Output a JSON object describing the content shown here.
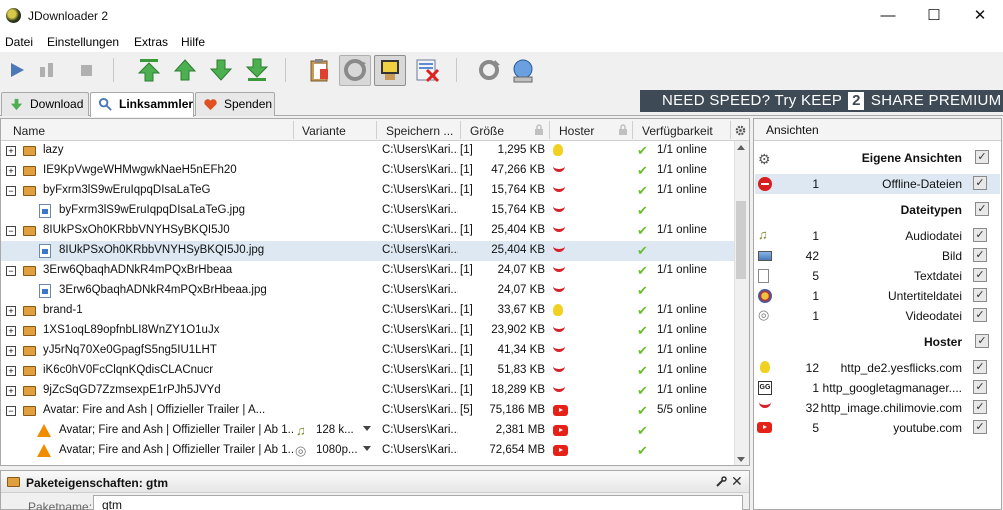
{
  "window": {
    "title": "JDownloader 2"
  },
  "menu": [
    "Datei",
    "Einstellungen",
    "Extras",
    "Hilfe"
  ],
  "tabs": [
    {
      "label": "Download",
      "active": false
    },
    {
      "label": "Linksammler",
      "active": true
    },
    {
      "label": "Spenden",
      "active": false
    }
  ],
  "premium": {
    "text1": "NEED SPEED? Try KEEP",
    "mid": "2",
    "text2": "SHARE PREMIUM"
  },
  "table": {
    "columns": [
      "Name",
      "Variante",
      "Speichern ...",
      "Größe",
      "Hoster",
      "Verfügbarkeit"
    ],
    "rows": [
      {
        "kind": "pkg",
        "exp": "+",
        "name": "lazy",
        "variant": "",
        "path": "C:\\Users\\Kari...",
        "count": "[1]",
        "size": "1,295 KB",
        "hoster": "yes",
        "avail": "1/1 online"
      },
      {
        "kind": "pkg",
        "exp": "+",
        "name": "IE9KpVwgeWHMwgwkNaeH5nEFh20",
        "variant": "",
        "path": "C:\\Users\\Kari...",
        "count": "[1]",
        "size": "47,266 KB",
        "hoster": "chili",
        "avail": "1/1 online"
      },
      {
        "kind": "pkg",
        "exp": "-",
        "name": "byFxrm3lS9wEruIqpqDIsaLaTeG",
        "variant": "",
        "path": "C:\\Users\\Kari...",
        "count": "[1]",
        "size": "15,764 KB",
        "hoster": "chili",
        "avail": "1/1 online"
      },
      {
        "kind": "file",
        "name": "byFxrm3lS9wEruIqpqDIsaLaTeG.jpg",
        "variant": "",
        "path": "C:\\Users\\Kari...",
        "count": "",
        "size": "15,764 KB",
        "hoster": "chili",
        "avail": ""
      },
      {
        "kind": "pkg",
        "exp": "-",
        "name": "8IUkPSxOh0KRbbVNYHSyBKQI5J0",
        "variant": "",
        "path": "C:\\Users\\Kari...",
        "count": "[1]",
        "size": "25,404 KB",
        "hoster": "chili",
        "avail": "1/1 online"
      },
      {
        "kind": "file",
        "sel": true,
        "name": "8IUkPSxOh0KRbbVNYHSyBKQI5J0.jpg",
        "variant": "",
        "path": "C:\\Users\\Kari...",
        "count": "",
        "size": "25,404 KB",
        "hoster": "chili",
        "avail": ""
      },
      {
        "kind": "pkg",
        "exp": "-",
        "name": "3Erw6QbaqhADNkR4mPQxBrHbeaa",
        "variant": "",
        "path": "C:\\Users\\Kari...",
        "count": "[1]",
        "size": "24,07 KB",
        "hoster": "chili",
        "avail": "1/1 online"
      },
      {
        "kind": "file",
        "name": "3Erw6QbaqhADNkR4mPQxBrHbeaa.jpg",
        "variant": "",
        "path": "C:\\Users\\Kari...",
        "count": "",
        "size": "24,07 KB",
        "hoster": "chili",
        "avail": ""
      },
      {
        "kind": "pkg",
        "exp": "+",
        "name": "brand-1",
        "variant": "",
        "path": "C:\\Users\\Kari...",
        "count": "[1]",
        "size": "33,67 KB",
        "hoster": "yes",
        "avail": "1/1 online"
      },
      {
        "kind": "pkg",
        "exp": "+",
        "name": "1XS1oqL89opfnbLI8WnZY1O1uJx",
        "variant": "",
        "path": "C:\\Users\\Kari...",
        "count": "[1]",
        "size": "23,902 KB",
        "hoster": "chili",
        "avail": "1/1 online"
      },
      {
        "kind": "pkg",
        "exp": "+",
        "name": "yJ5rNq70Xe0GpagfS5ng5IU1LHT",
        "variant": "",
        "path": "C:\\Users\\Kari...",
        "count": "[1]",
        "size": "41,34 KB",
        "hoster": "chili",
        "avail": "1/1 online"
      },
      {
        "kind": "pkg",
        "exp": "+",
        "name": "iK6c0hV0FcClqnKQdisCLACnucr",
        "variant": "",
        "path": "C:\\Users\\Kari...",
        "count": "[1]",
        "size": "51,83 KB",
        "hoster": "chili",
        "avail": "1/1 online"
      },
      {
        "kind": "pkg",
        "exp": "+",
        "name": "9jZcSqGD7ZzmsexpE1rPJh5JVYd",
        "variant": "",
        "path": "C:\\Users\\Kari...",
        "count": "[1]",
        "size": "18,289 KB",
        "hoster": "chili",
        "avail": "1/1 online"
      },
      {
        "kind": "pkg",
        "exp": "-",
        "name": "Avatar: Fire and Ash | Offizieller Trailer | A...",
        "variant": "",
        "path": "C:\\Users\\Kari...",
        "count": "[5]",
        "size": "75,186 MB",
        "hoster": "yt",
        "avail": "5/5 online"
      },
      {
        "kind": "vlc",
        "name": "Avatar; Fire and Ash | Offizieller Trailer | Ab 1...",
        "variant": "128 k...",
        "vicon": "music",
        "path": "C:\\Users\\Kari...",
        "count": "",
        "size": "2,381 MB",
        "hoster": "yt",
        "avail": ""
      },
      {
        "kind": "vlc",
        "name": "Avatar; Fire and Ash | Offizieller Trailer | Ab 1...",
        "variant": "1080p...",
        "vicon": "film",
        "path": "C:\\Users\\Kari...",
        "count": "",
        "size": "72,654 MB",
        "hoster": "yt",
        "avail": ""
      }
    ]
  },
  "props": {
    "title": "Paketeigenschaften: gtm",
    "label": "Paketname:",
    "value": "gtm"
  },
  "right": {
    "title": "Ansichten",
    "sections": [
      {
        "title": "Eigene Ansichten",
        "items": [
          {
            "count": "1",
            "label": "Offline-Dateien",
            "icon": "offline",
            "sel": true
          }
        ]
      },
      {
        "title": "Dateitypen",
        "items": [
          {
            "count": "1",
            "label": "Audiodatei",
            "icon": "audio"
          },
          {
            "count": "42",
            "label": "Bild",
            "icon": "image"
          },
          {
            "count": "5",
            "label": "Textdatei",
            "icon": "text"
          },
          {
            "count": "1",
            "label": "Untertiteldatei",
            "icon": "subtitle"
          },
          {
            "count": "1",
            "label": "Videodatei",
            "icon": "video"
          }
        ]
      },
      {
        "title": "Hoster",
        "items": [
          {
            "count": "12",
            "label": "http_de2.yesflicks.com",
            "icon": "yes"
          },
          {
            "count": "1",
            "label": "http_googletagmanager....",
            "icon": "gg"
          },
          {
            "count": "32",
            "label": "http_image.chilimovie.com",
            "icon": "chili"
          },
          {
            "count": "5",
            "label": "youtube.com",
            "icon": "yt"
          }
        ]
      }
    ]
  }
}
